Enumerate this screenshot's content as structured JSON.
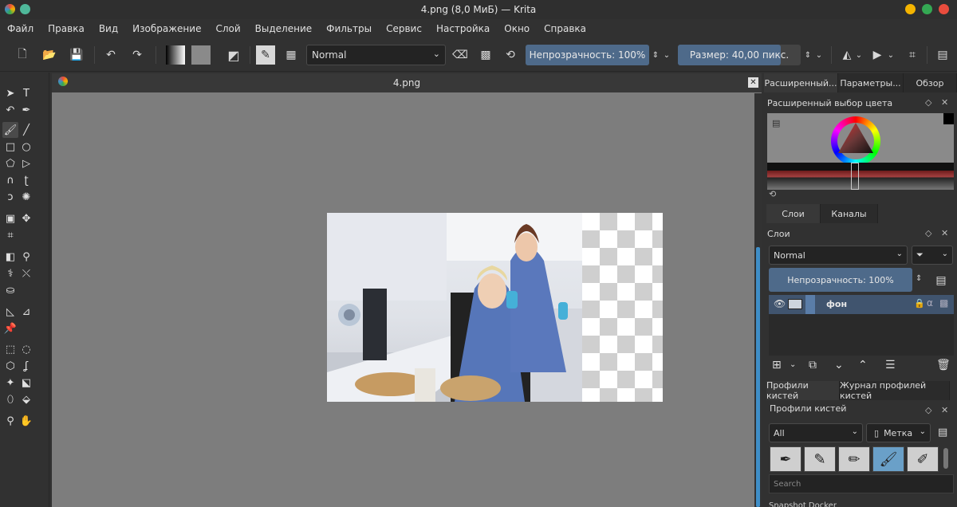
{
  "window": {
    "title": "4.png (8,0 МиБ) — Krita",
    "controls": [
      "minimize-icon",
      "maximize-icon",
      "close-icon"
    ],
    "colors": {
      "minimize": "#f4b400",
      "maximize": "#34a853",
      "close": "#e94c3d"
    }
  },
  "menu": [
    "Файл",
    "Правка",
    "Вид",
    "Изображение",
    "Слой",
    "Выделение",
    "Фильтры",
    "Сервис",
    "Настройка",
    "Окно",
    "Справка"
  ],
  "toolbar": {
    "blend_mode": "Normal",
    "opacity_label": "Непрозрачность: 100%",
    "opacity_value": 100,
    "size_label": "Размер: 40,00 пикс.",
    "size_fill_fraction": 0.84,
    "accent": "#4e6a8a"
  },
  "canvas": {
    "tab_title": "4.png"
  },
  "dockers": {
    "top_tabs": [
      "Расширенный...",
      "Параметры...",
      "Обзор"
    ],
    "color_panel_title": "Расширенный выбор цвета",
    "layer_tabs": [
      "Слои",
      "Каналы"
    ],
    "layers_title": "Слои",
    "layers_blend": "Normal",
    "layers_opacity": "Непрозрачность: 100%",
    "layer_name": "фон",
    "brush_tabs": [
      "Профили кистей",
      "Журнал профилей кистей"
    ],
    "brush_title": "Профили кистей",
    "brush_filter": "All",
    "brush_tag": "Метка",
    "search_placeholder": "Search",
    "snapshot_title": "Snapshot Docker"
  }
}
